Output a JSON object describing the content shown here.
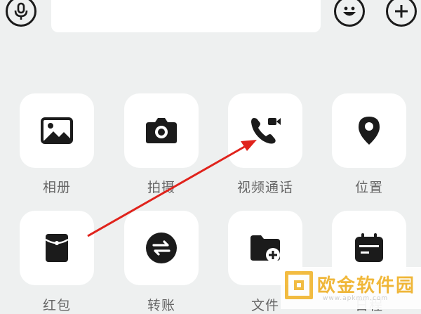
{
  "colors": {
    "background": "#eef0f0",
    "tile": "#ffffff",
    "icon": "#1b1b1b",
    "label": "#666666",
    "arrow": "#e0231c",
    "watermark": "#f0b22a"
  },
  "top_bar": {
    "voice_icon": "microphone-icon",
    "emoji_icon": "smiley-icon",
    "plus_icon": "plus-icon"
  },
  "grid": {
    "items": [
      {
        "label": "相册",
        "icon": "photo-icon"
      },
      {
        "label": "拍摄",
        "icon": "camera-icon"
      },
      {
        "label": "视频通话",
        "icon": "video-call-icon"
      },
      {
        "label": "位置",
        "icon": "location-pin-icon"
      },
      {
        "label": "红包",
        "icon": "red-packet-icon"
      },
      {
        "label": "转账",
        "icon": "transfer-icon"
      },
      {
        "label": "文件",
        "icon": "folder-add-icon"
      },
      {
        "label": "日程",
        "icon": "calendar-icon"
      }
    ]
  },
  "annotation": {
    "arrow_points_to": "视频通话"
  },
  "watermark": {
    "text": "欧金软件园",
    "url": "www.apkmm.com"
  }
}
